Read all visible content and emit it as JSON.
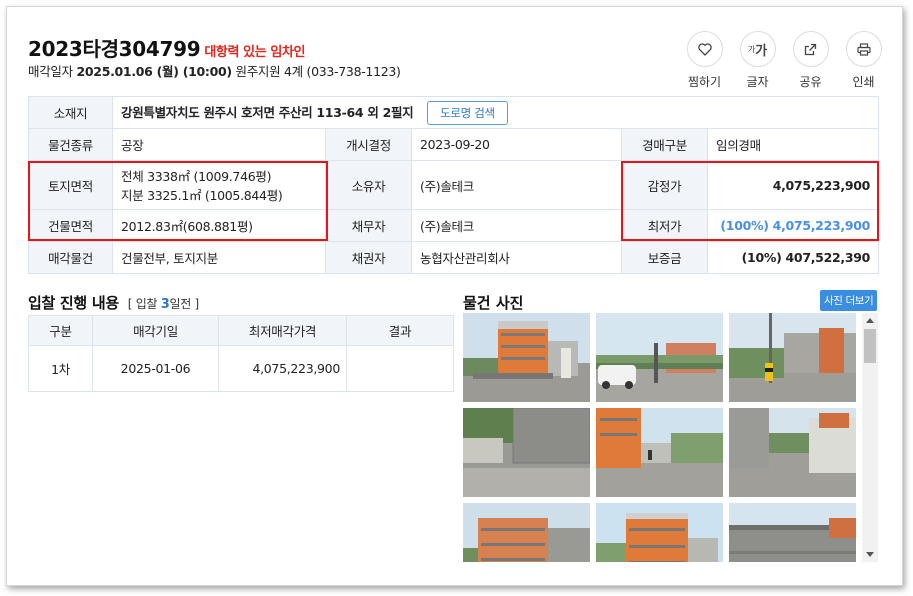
{
  "header": {
    "case_no": "2023타경304799",
    "badge": "대항력 있는 임차인",
    "sale_label": "매각일자",
    "sale_date": "2025.01.06 (월) (10:00)",
    "court": "원주지원 4계 (033-738-1123)"
  },
  "actions": [
    {
      "label": "찜하기",
      "icon": "heart-icon"
    },
    {
      "label": "글자",
      "icon": "text-size-icon"
    },
    {
      "label": "공유",
      "icon": "share-icon"
    },
    {
      "label": "인쇄",
      "icon": "print-icon"
    }
  ],
  "font_icon_text": "가",
  "font_icon_small": "가",
  "info": {
    "address_label": "소재지",
    "address": "강원특별자치도 원주시 호저면 주산리 113-64 외 2필지",
    "road_search": "도로명 검색",
    "type_label": "물건종류",
    "type": "공장",
    "start_label": "개시결정",
    "start": "2023-09-20",
    "auction_label": "경매구분",
    "auction": "임의경매",
    "land_label": "토지면적",
    "land_total": "전체 3338㎡ (1009.746평)",
    "land_share": "지분 3325.1㎡ (1005.844평)",
    "owner_label": "소유자",
    "owner": "(주)솔테크",
    "appraisal_label": "감정가",
    "appraisal": "4,075,223,900",
    "building_label": "건물면적",
    "building": "2012.83㎡(608.881평)",
    "debtor_label": "채무자",
    "debtor": "(주)솔테크",
    "min_label": "최저가",
    "min": "(100%) 4,075,223,900",
    "object_label": "매각물건",
    "object": "건물전부, 토지지분",
    "creditor_label": "채권자",
    "creditor": "농협자산관리회사",
    "deposit_label": "보증금",
    "deposit": "(10%) 407,522,390"
  },
  "bid": {
    "title": "입찰 진행 내용",
    "sub_prefix": "[ 입찰 ",
    "sub_num": "3",
    "sub_suffix": "일전 ]",
    "columns": [
      "구분",
      "매각기일",
      "최저매각가격",
      "결과"
    ],
    "rows": [
      {
        "round": "1차",
        "date": "2025-01-06",
        "price": "4,075,223,900",
        "result": ""
      }
    ]
  },
  "photos": {
    "title": "물건 사진",
    "more": "사진 더보기"
  },
  "colors": {
    "accent": "#2e78c6",
    "badge": "#e1261c",
    "highlight_box": "#e8141b",
    "min_price": "#4a90e2"
  }
}
